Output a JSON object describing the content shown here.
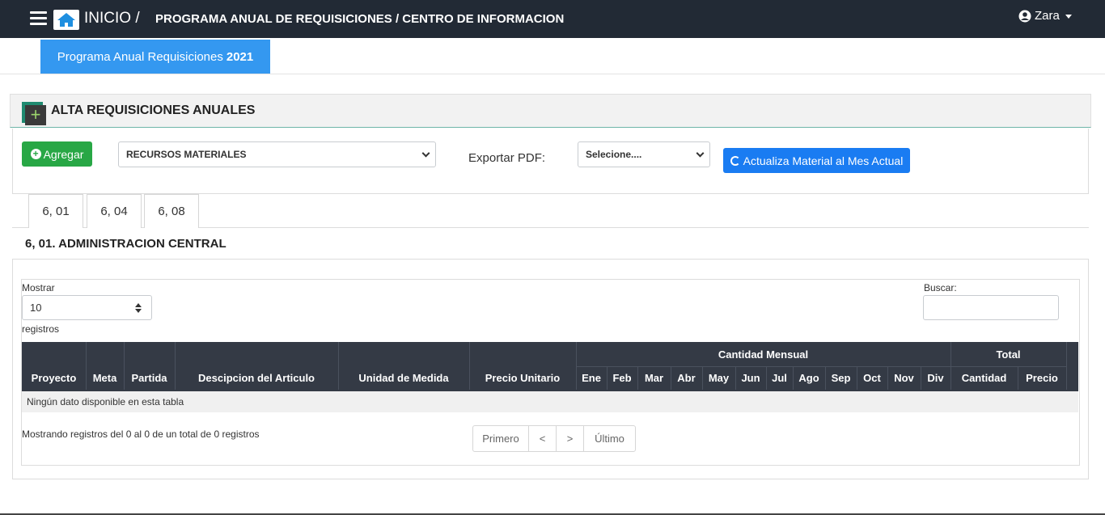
{
  "navbar": {
    "inicio": "INICIO /",
    "title": "PROGRAMA ANUAL DE REQUISICIONES / CENTRO DE INFORMACION",
    "user": "Zara"
  },
  "program_tab": {
    "label": "Programa Anual Requisiciones",
    "year": "2021"
  },
  "section": {
    "title": "ALTA REQUISICIONES ANUALES"
  },
  "toolbar": {
    "agregar_label": "Agregar",
    "recursos_value": "RECURSOS MATERIALES",
    "export_label": "Exportar PDF:",
    "pdf_value": "Selecione....",
    "actualiza_label": "Actualiza Material al Mes Actual"
  },
  "tabs": [
    "6, 01",
    "6, 04",
    "6, 08"
  ],
  "center_title": "6, 01. ADMINISTRACION CENTRAL",
  "table_controls": {
    "mostrar": "Mostrar",
    "length_value": "10",
    "registros": "registros",
    "buscar": "Buscar:"
  },
  "table": {
    "headers": {
      "proyecto": "Proyecto",
      "meta": "Meta",
      "partida": "Partida",
      "descripcion": "Descipcion del Articulo",
      "unidad": "Unidad de Medida",
      "precio_unitario": "Precio Unitario",
      "cantidad_mensual": "Cantidad Mensual",
      "total": "Total",
      "months": [
        "Ene",
        "Feb",
        "Mar",
        "Abr",
        "May",
        "Jun",
        "Jul",
        "Ago",
        "Sep",
        "Oct",
        "Nov",
        "Div"
      ],
      "cantidad": "Cantidad",
      "precio": "Precio"
    },
    "empty": "Ningún dato disponible en esta tabla",
    "info": "Mostrando registros del 0 al 0 de un total de 0 registros"
  },
  "pager": {
    "first": "Primero",
    "prev": "<",
    "next": ">",
    "last": "Último"
  },
  "colors": {
    "navbar": "#222a35",
    "tab_blue": "#3498f0",
    "green": "#28a745",
    "blue_btn": "#1a7cf2",
    "table_head": "#343a45"
  }
}
